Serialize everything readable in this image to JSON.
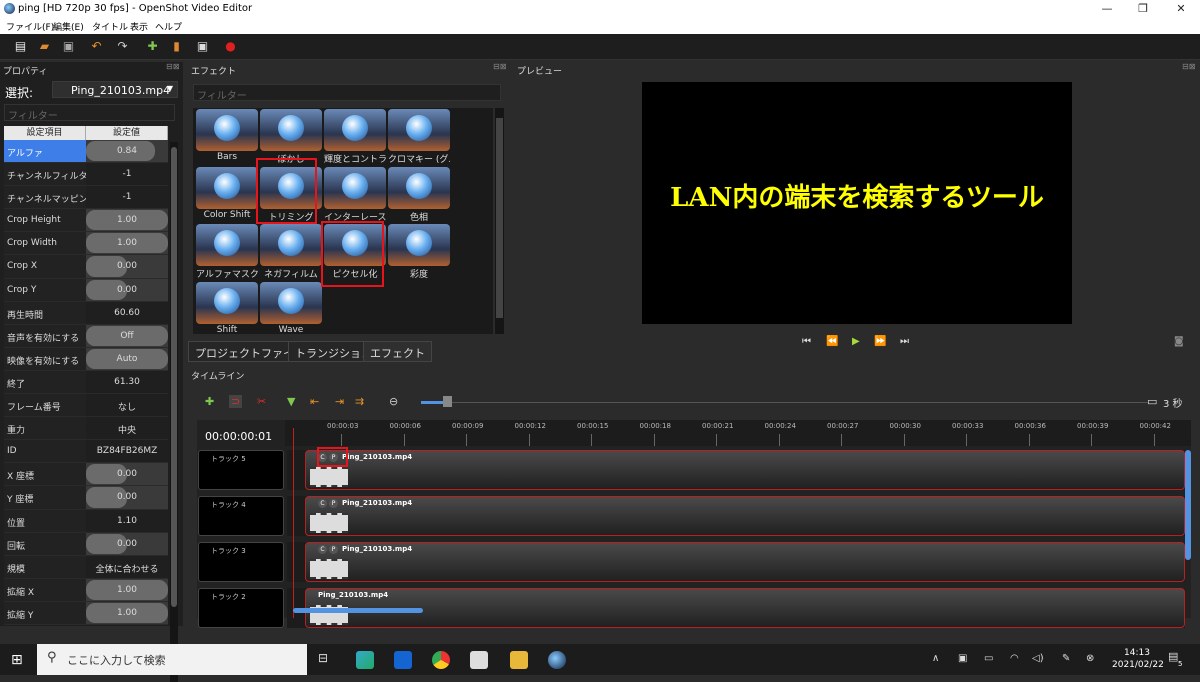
{
  "window": {
    "title": "ping [HD 720p 30 fps] - OpenShot Video Editor"
  },
  "menu": [
    "ファイル(F)",
    "編集(E)",
    "タイトル",
    "表示",
    "ヘルプ"
  ],
  "properties": {
    "header": "プロパティ",
    "select_label": "選択:",
    "selected_clip": "Ping_210103.mp4",
    "filter_placeholder": "フィルター",
    "col_key": "設定項目",
    "col_value": "設定値",
    "rows": [
      {
        "key": "アルファ",
        "value": "0.84",
        "fill": 0.84
      },
      {
        "key": "チャンネルフィルター",
        "value": "-1",
        "fill": 0
      },
      {
        "key": "チャンネルマッピング",
        "value": "-1",
        "fill": 0
      },
      {
        "key": "Crop Height",
        "value": "1.00",
        "fill": 1
      },
      {
        "key": "Crop Width",
        "value": "1.00",
        "fill": 1
      },
      {
        "key": "Crop X",
        "value": "0.00",
        "fill": 0.5
      },
      {
        "key": "Crop Y",
        "value": "0.00",
        "fill": 0.5
      },
      {
        "key": "再生時間",
        "value": "60.60",
        "fill": 0
      },
      {
        "key": "音声を有効にする",
        "value": "Off",
        "fill": 1
      },
      {
        "key": "映像を有効にする",
        "value": "Auto",
        "fill": 1
      },
      {
        "key": "終了",
        "value": "61.30",
        "fill": 0
      },
      {
        "key": "フレーム番号",
        "value": "なし",
        "fill": 0
      },
      {
        "key": "重力",
        "value": "中央",
        "fill": 0
      },
      {
        "key": "ID",
        "value": "BZ84FB26MZ",
        "fill": 0
      },
      {
        "key": "X 座標",
        "value": "0.00",
        "fill": 0.5
      },
      {
        "key": "Y 座標",
        "value": "0.00",
        "fill": 0.5
      },
      {
        "key": "位置",
        "value": "1.10",
        "fill": 0
      },
      {
        "key": "回転",
        "value": "0.00",
        "fill": 0.5
      },
      {
        "key": "規模",
        "value": "全体に合わせる",
        "fill": 0
      },
      {
        "key": "拡縮 X",
        "value": "1.00",
        "fill": 1
      },
      {
        "key": "拡縮 Y",
        "value": "1.00",
        "fill": 1
      }
    ]
  },
  "effects": {
    "header": "エフェクト",
    "filter_placeholder": "フィルター",
    "items": [
      "Bars",
      "ぼかし",
      "輝度とコントラ...",
      "クロマキー (グ...",
      "Color Shift",
      "トリミング",
      "インターレース",
      "色相",
      "アルファマスク ...",
      "ネガフィルム",
      "ピクセル化",
      "彩度",
      "Shift",
      "Wave"
    ]
  },
  "tabs": [
    "プロジェクトファイル",
    "トランジション",
    "エフェクト"
  ],
  "preview": {
    "header": "プレビュー",
    "text": "LAN内の端末を検索するツール"
  },
  "timeline": {
    "header": "タイムライン",
    "timecode": "00:00:00:01",
    "zoom_label": "3 秒",
    "ruler": [
      "00:00:03",
      "00:00:06",
      "00:00:09",
      "00:00:12",
      "00:00:15",
      "00:00:18",
      "00:00:21",
      "00:00:24",
      "00:00:27",
      "00:00:30",
      "00:00:33",
      "00:00:36",
      "00:00:39",
      "00:00:42"
    ],
    "tracks": [
      {
        "name": "トラック 5",
        "clip": "Ping_210103.mp4",
        "badges": true
      },
      {
        "name": "トラック 4",
        "clip": "Ping_210103.mp4",
        "badges": true
      },
      {
        "name": "トラック 3",
        "clip": "Ping_210103.mp4",
        "badges": true
      },
      {
        "name": "トラック 2",
        "clip": "Ping_210103.mp4",
        "badges": false
      }
    ]
  },
  "taskbar": {
    "search_placeholder": "ここに入力して検索",
    "time": "14:13",
    "date": "2021/02/22",
    "notifications": "5"
  }
}
